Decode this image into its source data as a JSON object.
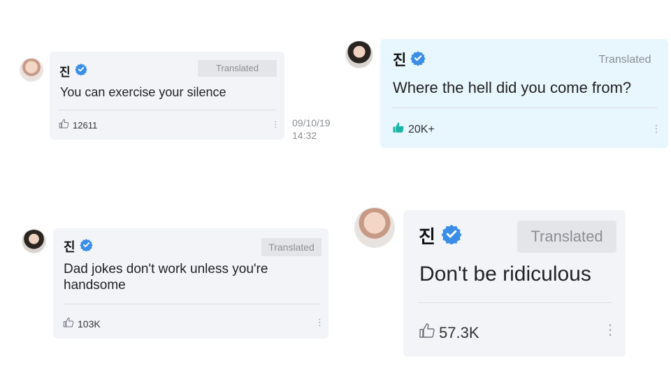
{
  "translated_label": "Translated",
  "posts": [
    {
      "author": "진",
      "text": "You can exercise your silence",
      "likes": "12611",
      "date": "09/10/19",
      "time": "14:32"
    },
    {
      "author": "진",
      "text": "Where the hell did you come from?",
      "likes": "20K+"
    },
    {
      "author": "진",
      "text": "Dad jokes don't work unless you're handsome",
      "likes": "103K"
    },
    {
      "author": "진",
      "text": "Don't be ridiculous",
      "likes": "57.3K"
    }
  ],
  "colors": {
    "verified": "#3b8ee8",
    "liked": "#1ab3a6"
  },
  "icons": {
    "verified": "verified-badge-icon",
    "like": "thumbs-up-icon",
    "more": "more-vertical-icon"
  }
}
